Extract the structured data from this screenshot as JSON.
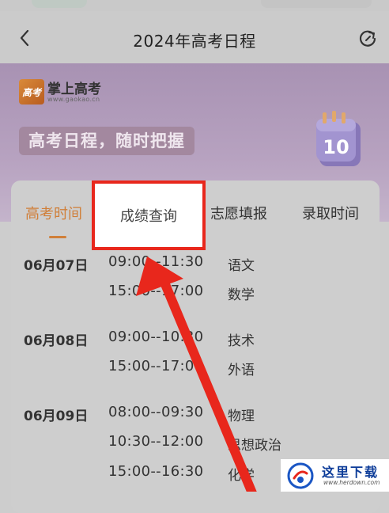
{
  "nav": {
    "title": "2024年高考日程",
    "back_icon": "chevron-left-icon",
    "refresh_icon": "refresh-icon"
  },
  "banner": {
    "logo_mark": "高考",
    "logo_name": "掌上高考",
    "logo_url": "www.gaokao.cn",
    "slogan": "高考日程，随时把握",
    "calendar_day": "10"
  },
  "tabs": [
    {
      "label": "高考时间",
      "active": true
    },
    {
      "label": "成绩查询",
      "active": false
    },
    {
      "label": "志愿填报",
      "active": false
    },
    {
      "label": "录取时间",
      "active": false
    }
  ],
  "schedule": [
    {
      "date": "06月07日",
      "sessions": [
        {
          "time": "09:00--11:30",
          "subject": "语文"
        },
        {
          "time": "15:00--17:00",
          "subject": "数学"
        }
      ]
    },
    {
      "date": "06月08日",
      "sessions": [
        {
          "time": "09:00--10:30",
          "subject": "技术"
        },
        {
          "time": "15:00--17:00",
          "subject": "外语"
        }
      ]
    },
    {
      "date": "06月09日",
      "sessions": [
        {
          "time": "08:00--09:30",
          "subject": "物理"
        },
        {
          "time": "10:30--12:00",
          "subject": "思想政治"
        },
        {
          "time": "15:00--16:30",
          "subject": "化学"
        }
      ]
    }
  ],
  "colors": {
    "accent": "#d07f39",
    "highlight": "#e8271c",
    "banner": "#a892b3"
  },
  "watermark": {
    "title": "这里下载",
    "url": "www.herdown.com"
  }
}
